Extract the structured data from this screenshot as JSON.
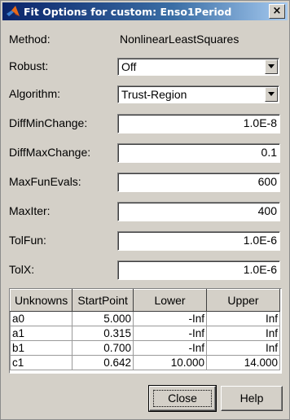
{
  "window": {
    "title": "Fit Options for custom: Enso1Period",
    "close_glyph": "×"
  },
  "method": {
    "label": "Method:",
    "value": "NonlinearLeastSquares"
  },
  "robust": {
    "label": "Robust:",
    "value": "Off"
  },
  "algorithm": {
    "label": "Algorithm:",
    "value": "Trust-Region"
  },
  "fields": {
    "diffminchange": {
      "label": "DiffMinChange:",
      "value": "1.0E-8"
    },
    "diffmaxchange": {
      "label": "DiffMaxChange:",
      "value": "0.1"
    },
    "maxfunevals": {
      "label": "MaxFunEvals:",
      "value": "600"
    },
    "maxiter": {
      "label": "MaxIter:",
      "value": "400"
    },
    "tolfun": {
      "label": "TolFun:",
      "value": "1.0E-6"
    },
    "tolx": {
      "label": "TolX:",
      "value": "1.0E-6"
    }
  },
  "table": {
    "headers": [
      "Unknowns",
      "StartPoint",
      "Lower",
      "Upper"
    ],
    "rows": [
      [
        "a0",
        "5.000",
        "-Inf",
        "Inf"
      ],
      [
        "a1",
        "0.315",
        "-Inf",
        "Inf"
      ],
      [
        "b1",
        "0.700",
        "-Inf",
        "Inf"
      ],
      [
        "c1",
        "0.642",
        "10.000",
        "14.000"
      ]
    ]
  },
  "buttons": {
    "close": "Close",
    "help": "Help"
  },
  "colors": {
    "titlebar_start": "#0a246a",
    "face": "#d4d0c8"
  }
}
